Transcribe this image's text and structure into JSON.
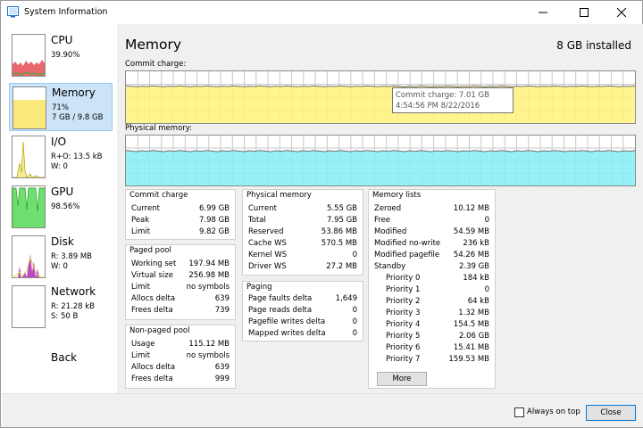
{
  "window": {
    "title": "System Information"
  },
  "sidebar": {
    "items": [
      {
        "name": "CPU",
        "line1": "39.90%",
        "line2": "",
        "color": "#e8686e"
      },
      {
        "name": "Memory",
        "line1": "71%",
        "line2": "7 GB / 9.8 GB",
        "color": "#f9e97a"
      },
      {
        "name": "I/O",
        "line1": "R+O: 13.5 kB",
        "line2": "W: 0",
        "color": "#f4eb95"
      },
      {
        "name": "GPU",
        "line1": "98.56%",
        "line2": "",
        "color": "#6fe06f"
      },
      {
        "name": "Disk",
        "line1": "R: 3.89 MB",
        "line2": "W: 0",
        "color": "#b94ac4"
      },
      {
        "name": "Network",
        "line1": "R: 21.28 kB",
        "line2": "S: 50 B",
        "color": "#f0e37a"
      }
    ],
    "back_label": "Back"
  },
  "main": {
    "heading": "Memory",
    "installed": "8 GB installed",
    "commit_graph": {
      "label": "Commit charge:",
      "fill_fraction": 0.71,
      "color": "#fff27a"
    },
    "physical_graph": {
      "label": "Physical memory:",
      "fill_fraction": 0.69,
      "color": "#83eef3"
    },
    "tooltip": {
      "line1": "Commit charge: 7.01 GB",
      "line2": "4:54:56 PM 8/22/2016"
    }
  },
  "panels": {
    "commit_charge": {
      "title": "Commit charge",
      "rows": [
        {
          "k": "Current",
          "v": "6.99 GB"
        },
        {
          "k": "Peak",
          "v": "7.98 GB"
        },
        {
          "k": "Limit",
          "v": "9.82 GB"
        }
      ]
    },
    "paged_pool": {
      "title": "Paged pool",
      "rows": [
        {
          "k": "Working set",
          "v": "197.94 MB"
        },
        {
          "k": "Virtual size",
          "v": "256.98 MB"
        },
        {
          "k": "Limit",
          "v": "no symbols"
        },
        {
          "k": "Allocs delta",
          "v": "639"
        },
        {
          "k": "Frees delta",
          "v": "739"
        }
      ]
    },
    "nonpaged_pool": {
      "title": "Non-paged pool",
      "rows": [
        {
          "k": "Usage",
          "v": "115.12 MB"
        },
        {
          "k": "Limit",
          "v": "no symbols"
        },
        {
          "k": "Allocs delta",
          "v": "639"
        },
        {
          "k": "Frees delta",
          "v": "999"
        }
      ]
    },
    "physical_memory": {
      "title": "Physical memory",
      "rows": [
        {
          "k": "Current",
          "v": "5.55 GB"
        },
        {
          "k": "Total",
          "v": "7.95 GB"
        },
        {
          "k": "Reserved",
          "v": "53.86 MB"
        },
        {
          "k": "Cache WS",
          "v": "570.5 MB"
        },
        {
          "k": "Kernel WS",
          "v": "0"
        },
        {
          "k": "Driver WS",
          "v": "27.2 MB"
        }
      ]
    },
    "paging": {
      "title": "Paging",
      "rows": [
        {
          "k": "Page faults delta",
          "v": "1,649"
        },
        {
          "k": "Page reads delta",
          "v": "0"
        },
        {
          "k": "Pagefile writes delta",
          "v": "0"
        },
        {
          "k": "Mapped writes delta",
          "v": "0"
        }
      ]
    },
    "memory_lists": {
      "title": "Memory lists",
      "rows": [
        {
          "k": "Zeroed",
          "v": "10.12 MB"
        },
        {
          "k": "Free",
          "v": "0"
        },
        {
          "k": "Modified",
          "v": "54.59 MB"
        },
        {
          "k": "Modified no-write",
          "v": "236 kB"
        },
        {
          "k": "Modified pagefile",
          "v": "54.26 MB"
        },
        {
          "k": "Standby",
          "v": "2.39 GB"
        },
        {
          "k": "Priority 0",
          "v": "184 kB",
          "indent": true
        },
        {
          "k": "Priority 1",
          "v": "0",
          "indent": true
        },
        {
          "k": "Priority 2",
          "v": "64 kB",
          "indent": true
        },
        {
          "k": "Priority 3",
          "v": "1.32 MB",
          "indent": true
        },
        {
          "k": "Priority 4",
          "v": "154.5 MB",
          "indent": true
        },
        {
          "k": "Priority 5",
          "v": "2.06 GB",
          "indent": true
        },
        {
          "k": "Priority 6",
          "v": "15.41 MB",
          "indent": true
        },
        {
          "k": "Priority 7",
          "v": "159.53 MB",
          "indent": true
        }
      ],
      "more_label": "More"
    }
  },
  "footer": {
    "always_on_top_label": "Always on top",
    "always_on_top_checked": false,
    "close_label": "Close"
  }
}
